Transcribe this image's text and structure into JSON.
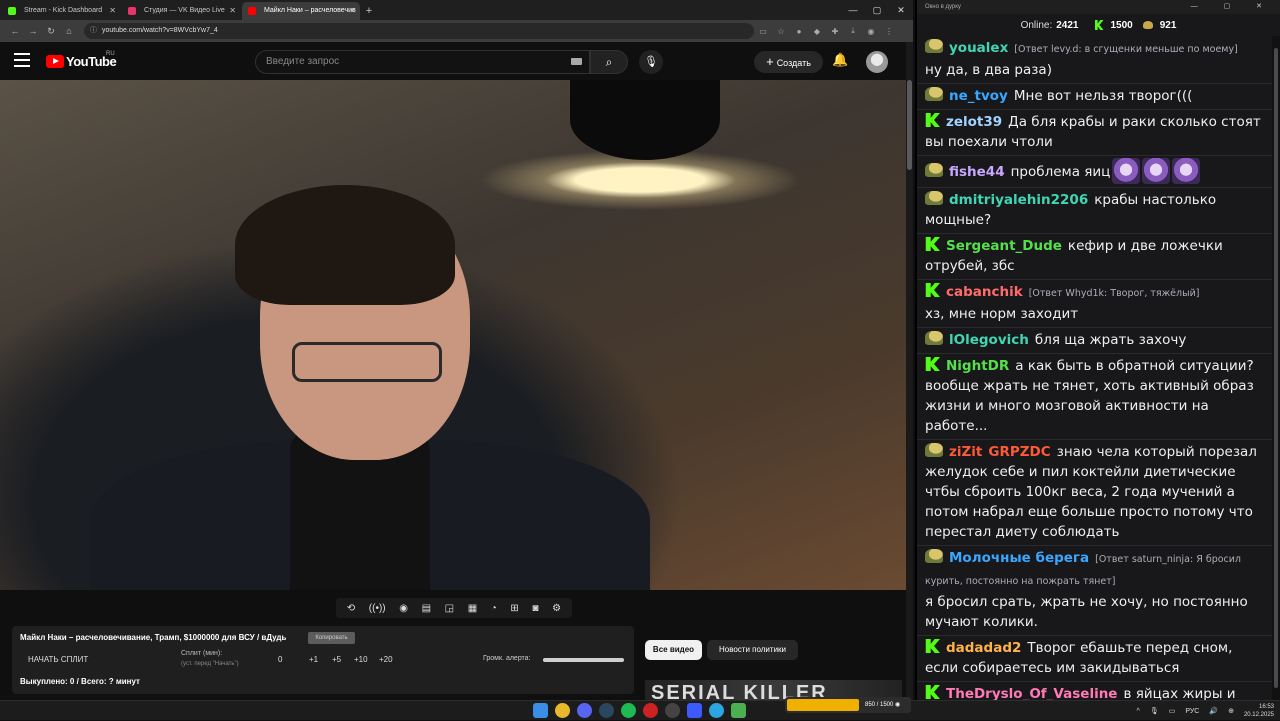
{
  "browser": {
    "tabs": [
      {
        "label": "Stream - Kick Dashboard",
        "color": "#53fc18"
      },
      {
        "label": "Студия — VK Видео Live",
        "color": "#e8346a"
      },
      {
        "label": "Майкл Наки – расчеловечив",
        "color": "#ff0000"
      }
    ],
    "url": "youtube.com/watch?v=8WVcbYw7_4"
  },
  "youtube": {
    "logo_text": "YouTube",
    "region": "RU",
    "search_placeholder": "Введите запрос",
    "create_label": "Создать"
  },
  "panel": {
    "title": "Майкл Наки – расчеловечивание, Трамп, $1000000 для ВСУ / вДудь",
    "copy_label": "Копировать",
    "split_button": "НАЧАТЬ СПЛИТ",
    "split_label": "Сплит (мин):",
    "split_hint": "(уст. перед \"Начать\")",
    "split_values": [
      "0",
      "+1",
      "+5",
      "+10",
      "+20"
    ],
    "alert_label": "Громк. алерта:",
    "alert_volume": 1.0,
    "bought": "Выкуплено: 0 / Всего: ? минут"
  },
  "chips": {
    "all": "Все видео",
    "news": "Новости политики"
  },
  "thumbnail_text": "SERIAL KILLER",
  "chat": {
    "window_title": "Окно в дурку",
    "online_label": "Online:",
    "online": "2421",
    "kick_count": "1500",
    "coin_count": "921",
    "messages": [
      {
        "badge": "frog",
        "user": "youalex",
        "color": "#3fd6b4",
        "reply": "[Ответ levy.d: в сгущенки меньше по моему]",
        "text": "ну да,  в два раза)",
        "emotes": 0
      },
      {
        "badge": "frog",
        "user": "ne_tvoy",
        "color": "#3aa7ff",
        "reply": "",
        "text": "Мне вот нельзя творог(((",
        "emotes": 0
      },
      {
        "badge": "k",
        "user": "zelot39",
        "color": "#a3d3ff",
        "reply": "",
        "text": "Да бля крабы и раки сколько стоят вы поехали чтоли",
        "emotes": 0
      },
      {
        "badge": "frog",
        "user": "fishe44",
        "color": "#c9a7ff",
        "reply": "",
        "text": "проблема яиц",
        "emotes": 3
      },
      {
        "badge": "frog",
        "user": "dmitriyalehin2206",
        "color": "#3fd6b4",
        "reply": "",
        "text": "крабы настолько мощные?",
        "emotes": 0
      },
      {
        "badge": "k",
        "user": "Sergeant_Dude",
        "color": "#55e04b",
        "reply": "",
        "text": "кефир и две ложечки отрубей, збс",
        "emotes": 0
      },
      {
        "badge": "k",
        "user": "cabanchik",
        "color": "#ff6b6b",
        "reply": "[Ответ Whyd1k: Творог, тяжёлый]",
        "text": "хз, мне норм заходит",
        "emotes": 0
      },
      {
        "badge": "frog",
        "user": "lOlegovich",
        "color": "#3fd6b4",
        "reply": "",
        "text": "бля ща жрать захочу",
        "emotes": 0
      },
      {
        "badge": "k",
        "user": "NightDR",
        "color": "#55e04b",
        "reply": "",
        "text": "а как быть в обратной ситуации? вообще жрать не тянет, хоть активный образ жизни и много мозговой активности на работе...",
        "emotes": 0
      },
      {
        "badge": "frog",
        "user": "ziZit",
        "color": "#ff5a36",
        "reply": "",
        "text": "знаю чела который порезал желудок себе и пил коктейли диетические чтбы сброить 100кг веса, 2 года мучений а потом набрал еще больше просто потому что перестал диету соблюдать",
        "emotes": 0,
        "tag": "GRPZDC",
        "tag_color": "#ff5a36"
      },
      {
        "badge": "frog",
        "user": "Молочные берега",
        "color": "#3aa7ff",
        "reply": "[Ответ saturn_ninja: Я бросил курить, постоянно на пожрать тянет]",
        "text": "я бросил срать, жрать не хочу, но постоянно мучают колики.",
        "emotes": 0
      },
      {
        "badge": "k",
        "user": "dadadad2",
        "color": "#ffb347",
        "reply": "",
        "text": "Творог ебашьте перед сном, если собираетесь им закидываться",
        "emotes": 0
      },
      {
        "badge": "k",
        "user": "TheDryslo_Of_Vaseline",
        "color": "#ff7ab6",
        "reply": "",
        "text": "в яйцах жиры и холестерин",
        "emotes": 0
      }
    ]
  },
  "taskbar": {
    "widget_text": "850 / 1500 ◉",
    "lang": "РУС",
    "time": "16:53",
    "date": "20.12.2025"
  }
}
